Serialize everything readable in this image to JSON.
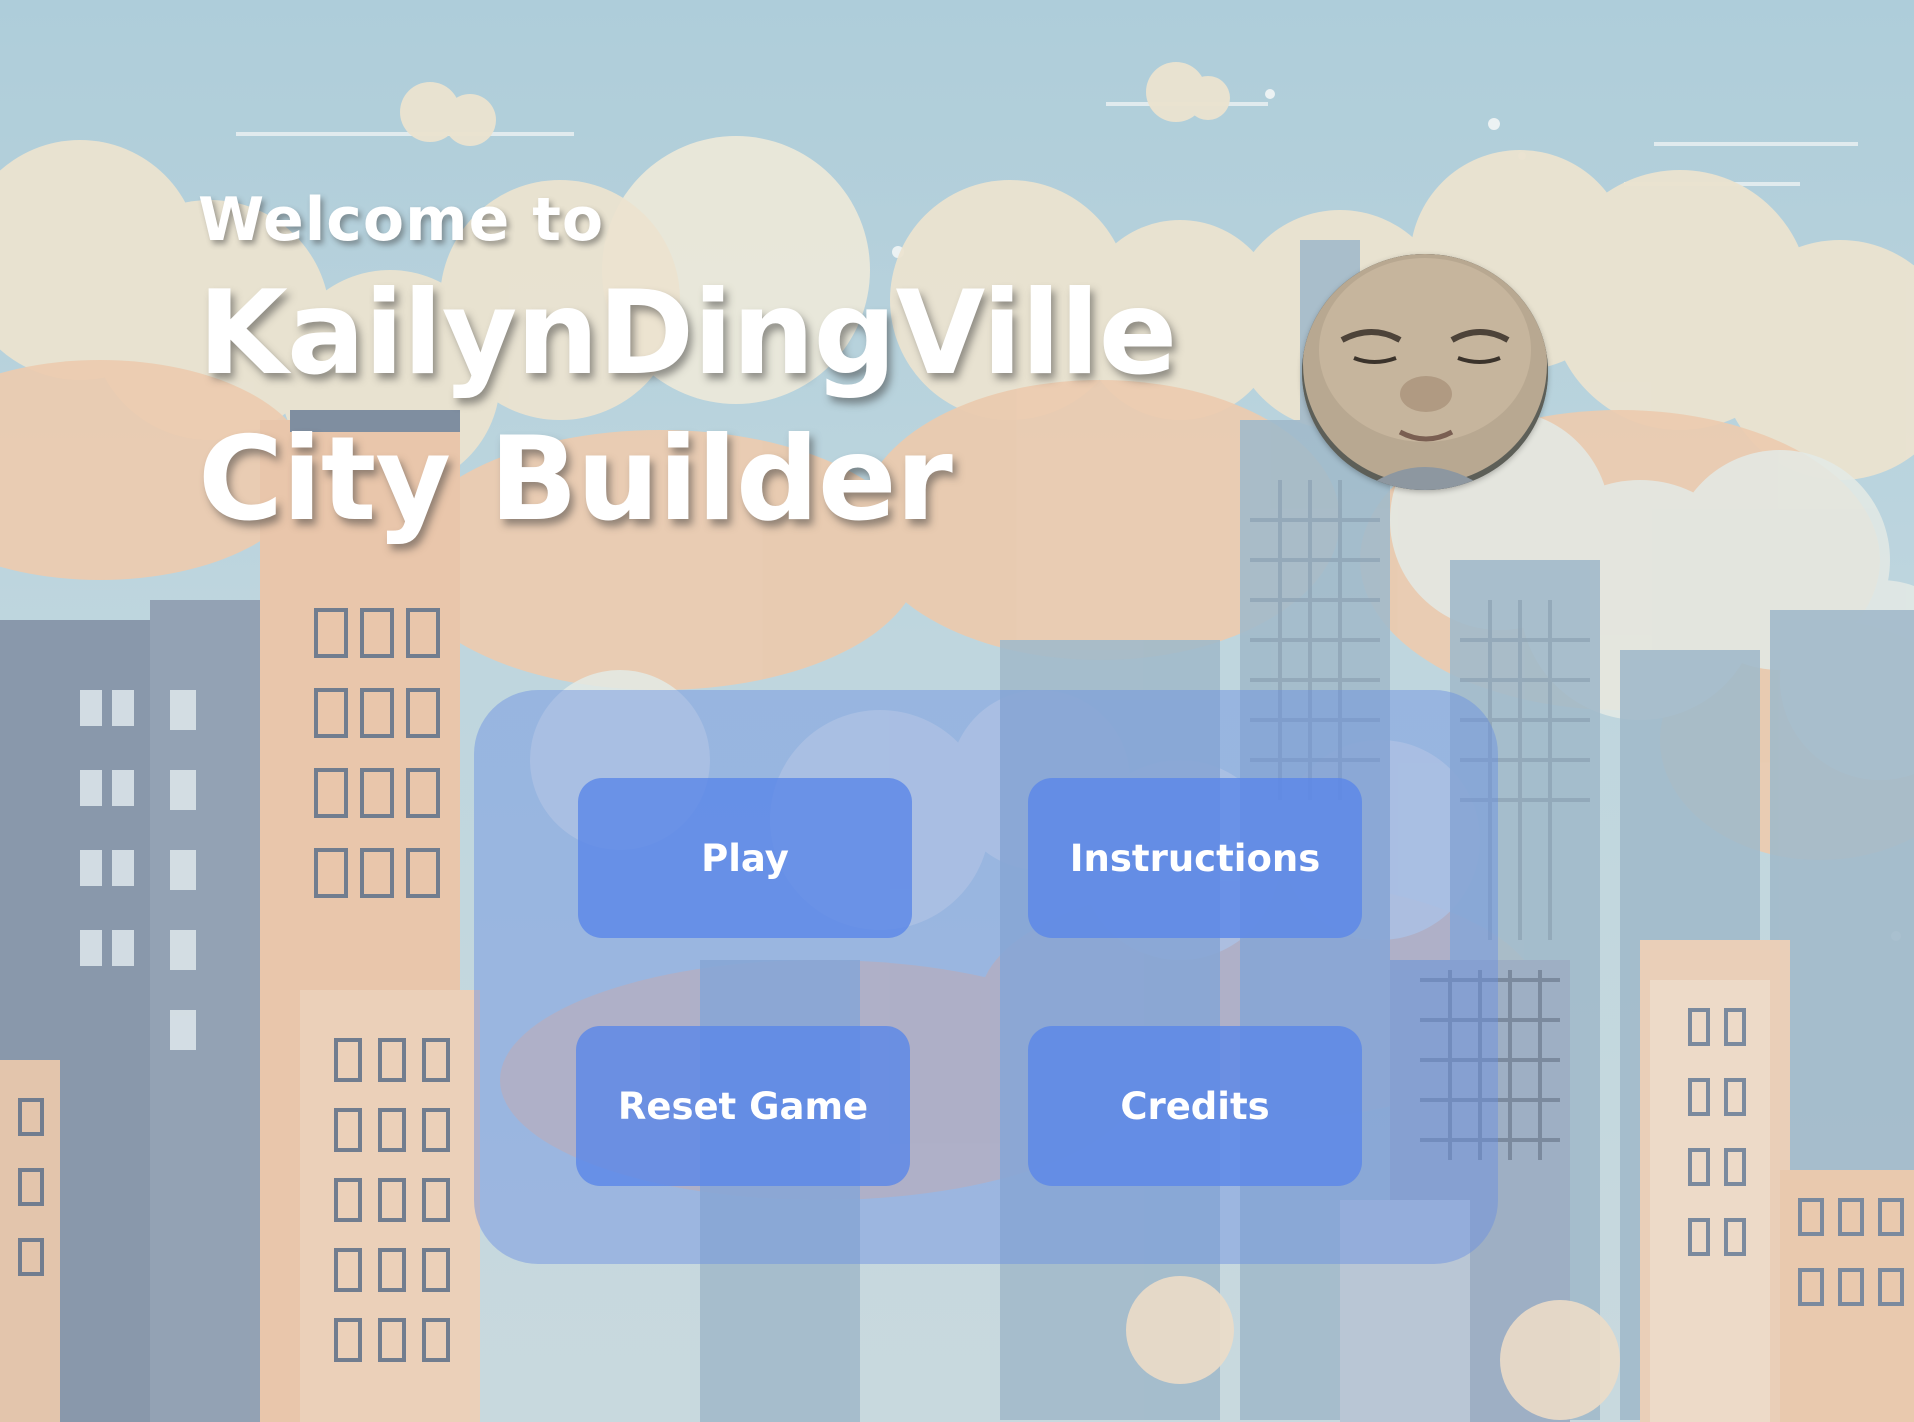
{
  "title": {
    "welcome": "Welcome to",
    "line1": "KailynDingVille",
    "line2": "City Builder"
  },
  "menu": {
    "play_label": "Play",
    "instructions_label": "Instructions",
    "reset_label": "Reset Game",
    "credits_label": "Credits"
  },
  "colors": {
    "sky": "#b6d3df",
    "cloud_cream": "#f6e8cf",
    "peach": "#f2c6a2",
    "building_slate": "#6f7f95",
    "panel_blue": "#698de2",
    "button_blue": "#5c88e8",
    "text_white": "#ffffff"
  },
  "icons": {
    "avatar": "player-photo-avatar"
  }
}
